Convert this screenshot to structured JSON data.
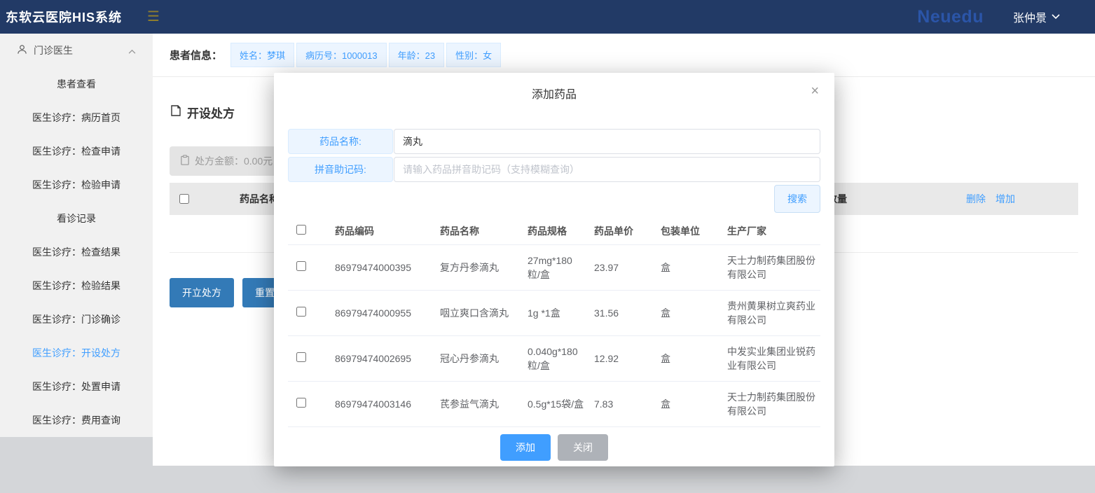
{
  "colors": {
    "accent": "#409eff",
    "topbar_bg": "#223a66",
    "brand_blue": "#2b55a8",
    "primary_action_blue": "#337ab7",
    "close_button_gray": "#aeb2b8"
  },
  "topbar": {
    "title": "东软云医院HIS系统",
    "menu_icon": "hamburger-icon",
    "brand": "Neuedu",
    "user_name": "张仲景"
  },
  "sidebar": {
    "header": {
      "label": "门诊医生",
      "icon": "person-icon",
      "chevron": "chevron-up-icon"
    },
    "items": [
      {
        "label": "患者查看"
      },
      {
        "label": "医生诊疗：病历首页"
      },
      {
        "label": "医生诊疗：检查申请"
      },
      {
        "label": "医生诊疗：检验申请"
      },
      {
        "label": "看诊记录"
      },
      {
        "label": "医生诊疗：检查结果"
      },
      {
        "label": "医生诊疗：检验结果"
      },
      {
        "label": "医生诊疗：门诊确诊"
      },
      {
        "label": "医生诊疗：开设处方",
        "active": true
      },
      {
        "label": "医生诊疗：处置申请"
      },
      {
        "label": "医生诊疗：费用查询"
      }
    ]
  },
  "patient_bar": {
    "label": "患者信息：",
    "tags": [
      "姓名：梦琪",
      "病历号：1000013",
      "年龄：23",
      "性别：女"
    ]
  },
  "prescription": {
    "page_title": "开设处方",
    "amount_label": "处方金额：0.00元",
    "header": {
      "drug_name": "药品名称",
      "quantity": "数量",
      "delete_link": "删除",
      "add_link": "增加"
    },
    "create_button": "开立处方",
    "reset_button": "重置处方"
  },
  "modal": {
    "title": "添加药品",
    "close": "×",
    "form": {
      "name_label": "药品名称:",
      "name_value": "滴丸",
      "pinyin_label": "拼音助记码:",
      "pinyin_placeholder": "请输入药品拼音助记码（支持模糊查询）",
      "search_button": "搜索"
    },
    "table": {
      "columns": [
        "药品编码",
        "药品名称",
        "药品规格",
        "药品单价",
        "包装单位",
        "生产厂家"
      ],
      "rows": [
        {
          "code": "86979474000395",
          "name": "复方丹参滴丸",
          "spec": "27mg*180粒/盒",
          "price": "23.97",
          "unit": "盒",
          "manufacturer": "天士力制药集团股份有限公司"
        },
        {
          "code": "86979474000955",
          "name": "咽立爽口含滴丸",
          "spec": "1g *1盒",
          "price": "31.56",
          "unit": "盒",
          "manufacturer": "贵州黄果树立爽药业有限公司"
        },
        {
          "code": "86979474002695",
          "name": "冠心丹参滴丸",
          "spec": "0.040g*180粒/盒",
          "price": "12.92",
          "unit": "盒",
          "manufacturer": "中发实业集团业锐药业有限公司"
        },
        {
          "code": "86979474003146",
          "name": "芪参益气滴丸",
          "spec": "0.5g*15袋/盒",
          "price": "7.83",
          "unit": "盒",
          "manufacturer": "天士力制药集团股份有限公司"
        }
      ]
    },
    "footer": {
      "add_button": "添加",
      "close_button": "关闭"
    }
  }
}
